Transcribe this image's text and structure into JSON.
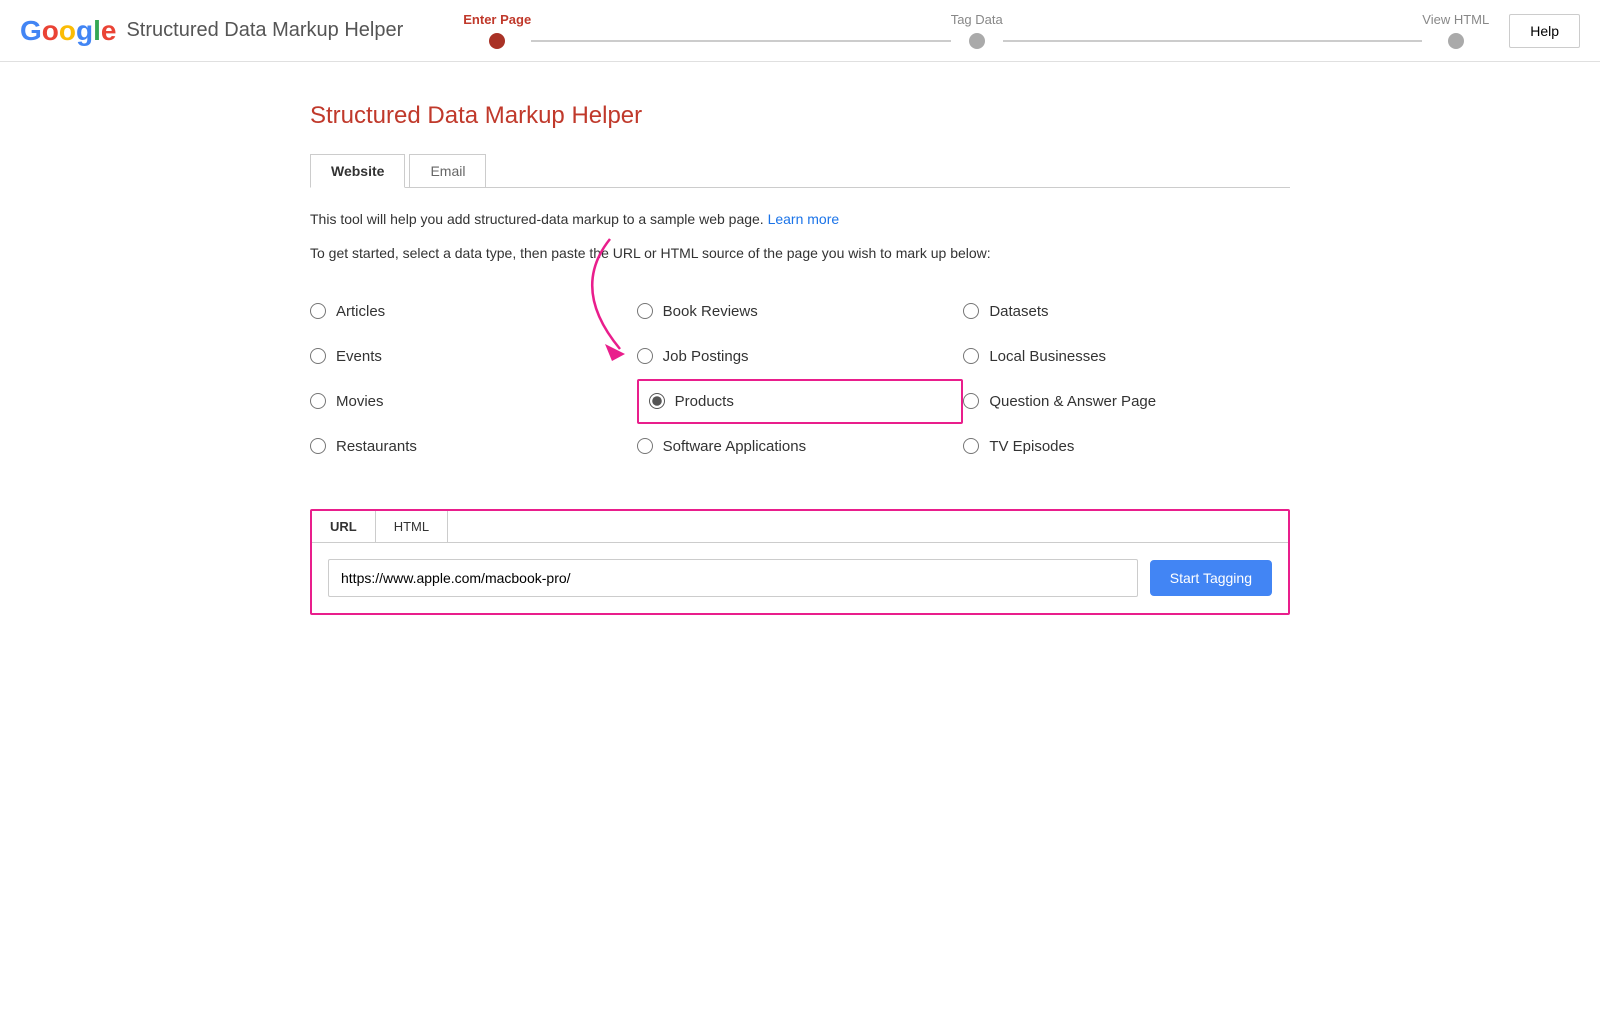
{
  "header": {
    "logo_letters": [
      "G",
      "o",
      "o",
      "g",
      "l",
      "e"
    ],
    "title": "Structured Data Markup Helper",
    "help_button": "Help",
    "steps": [
      {
        "label": "Enter Page",
        "active": true
      },
      {
        "label": "Tag Data",
        "active": false
      },
      {
        "label": "View HTML",
        "active": false
      }
    ]
  },
  "page": {
    "heading": "Structured Data Markup Helper",
    "tabs": [
      {
        "label": "Website",
        "active": true
      },
      {
        "label": "Email",
        "active": false
      }
    ],
    "desc1": "This tool will help you add structured-data markup to a sample web page.",
    "learn_more": "Learn more",
    "desc2": "To get started, select a data type, then paste the URL or HTML source of the page you wish to mark up below:",
    "radio_options": [
      {
        "id": "articles",
        "label": "Articles",
        "checked": false,
        "col": 1
      },
      {
        "id": "book-reviews",
        "label": "Book Reviews",
        "checked": false,
        "col": 2
      },
      {
        "id": "datasets",
        "label": "Datasets",
        "checked": false,
        "col": 3
      },
      {
        "id": "events",
        "label": "Events",
        "checked": false,
        "col": 1
      },
      {
        "id": "job-postings",
        "label": "Job Postings",
        "checked": false,
        "col": 2
      },
      {
        "id": "local-businesses",
        "label": "Local Businesses",
        "checked": false,
        "col": 3
      },
      {
        "id": "movies",
        "label": "Movies",
        "checked": false,
        "col": 1
      },
      {
        "id": "products",
        "label": "Products",
        "checked": true,
        "col": 2,
        "highlighted": true
      },
      {
        "id": "question-answer",
        "label": "Question & Answer Page",
        "checked": false,
        "col": 3
      },
      {
        "id": "restaurants",
        "label": "Restaurants",
        "checked": false,
        "col": 1
      },
      {
        "id": "software-applications",
        "label": "Software Applications",
        "checked": false,
        "col": 2
      },
      {
        "id": "tv-episodes",
        "label": "TV Episodes",
        "checked": false,
        "col": 3
      }
    ],
    "url_section": {
      "tabs": [
        {
          "label": "URL",
          "active": true
        },
        {
          "label": "HTML",
          "active": false
        }
      ],
      "url_placeholder": "https://www.apple.com/macbook-pro/",
      "url_value": "https://www.apple.com/macbook-pro/",
      "start_tagging_label": "Start Tagging"
    }
  },
  "colors": {
    "accent_red": "#C0392B",
    "google_blue": "#4285F4",
    "google_red": "#EA4335",
    "google_yellow": "#FBBC05",
    "google_green": "#34A853",
    "pink_highlight": "#E91E8C",
    "start_btn_blue": "#4285F4"
  }
}
